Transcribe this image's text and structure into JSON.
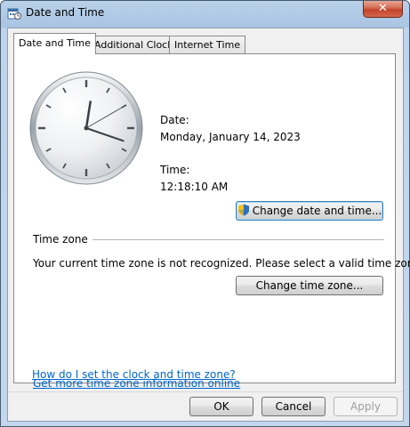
{
  "window": {
    "title": "Date and Time",
    "close_glyph": "✕",
    "icon": "date-time-icon"
  },
  "tabs": [
    {
      "label": "Date and Time",
      "active": true
    },
    {
      "label": "Additional Clocks",
      "active": false
    },
    {
      "label": "Internet Time",
      "active": false
    }
  ],
  "datetime": {
    "date_label": "Date:",
    "date_value": "Monday, January 14, 2023",
    "time_label": "Time:",
    "time_value": "12:18:10 AM",
    "change_button": "Change date and time..."
  },
  "timezone": {
    "heading": "Time zone",
    "message": "Your current time zone is not recognized. Please select a valid time zone.",
    "change_button": "Change time zone..."
  },
  "links": {
    "more_info": "Get more time zone information online",
    "how_to": "How do I set the clock and time zone?"
  },
  "footer": {
    "ok": "OK",
    "cancel": "Cancel",
    "apply": "Apply"
  },
  "clock": {
    "hour": 12,
    "minute": 18,
    "second": 10
  },
  "colors": {
    "link": "#0066cc",
    "close_button": "#c4422b"
  }
}
